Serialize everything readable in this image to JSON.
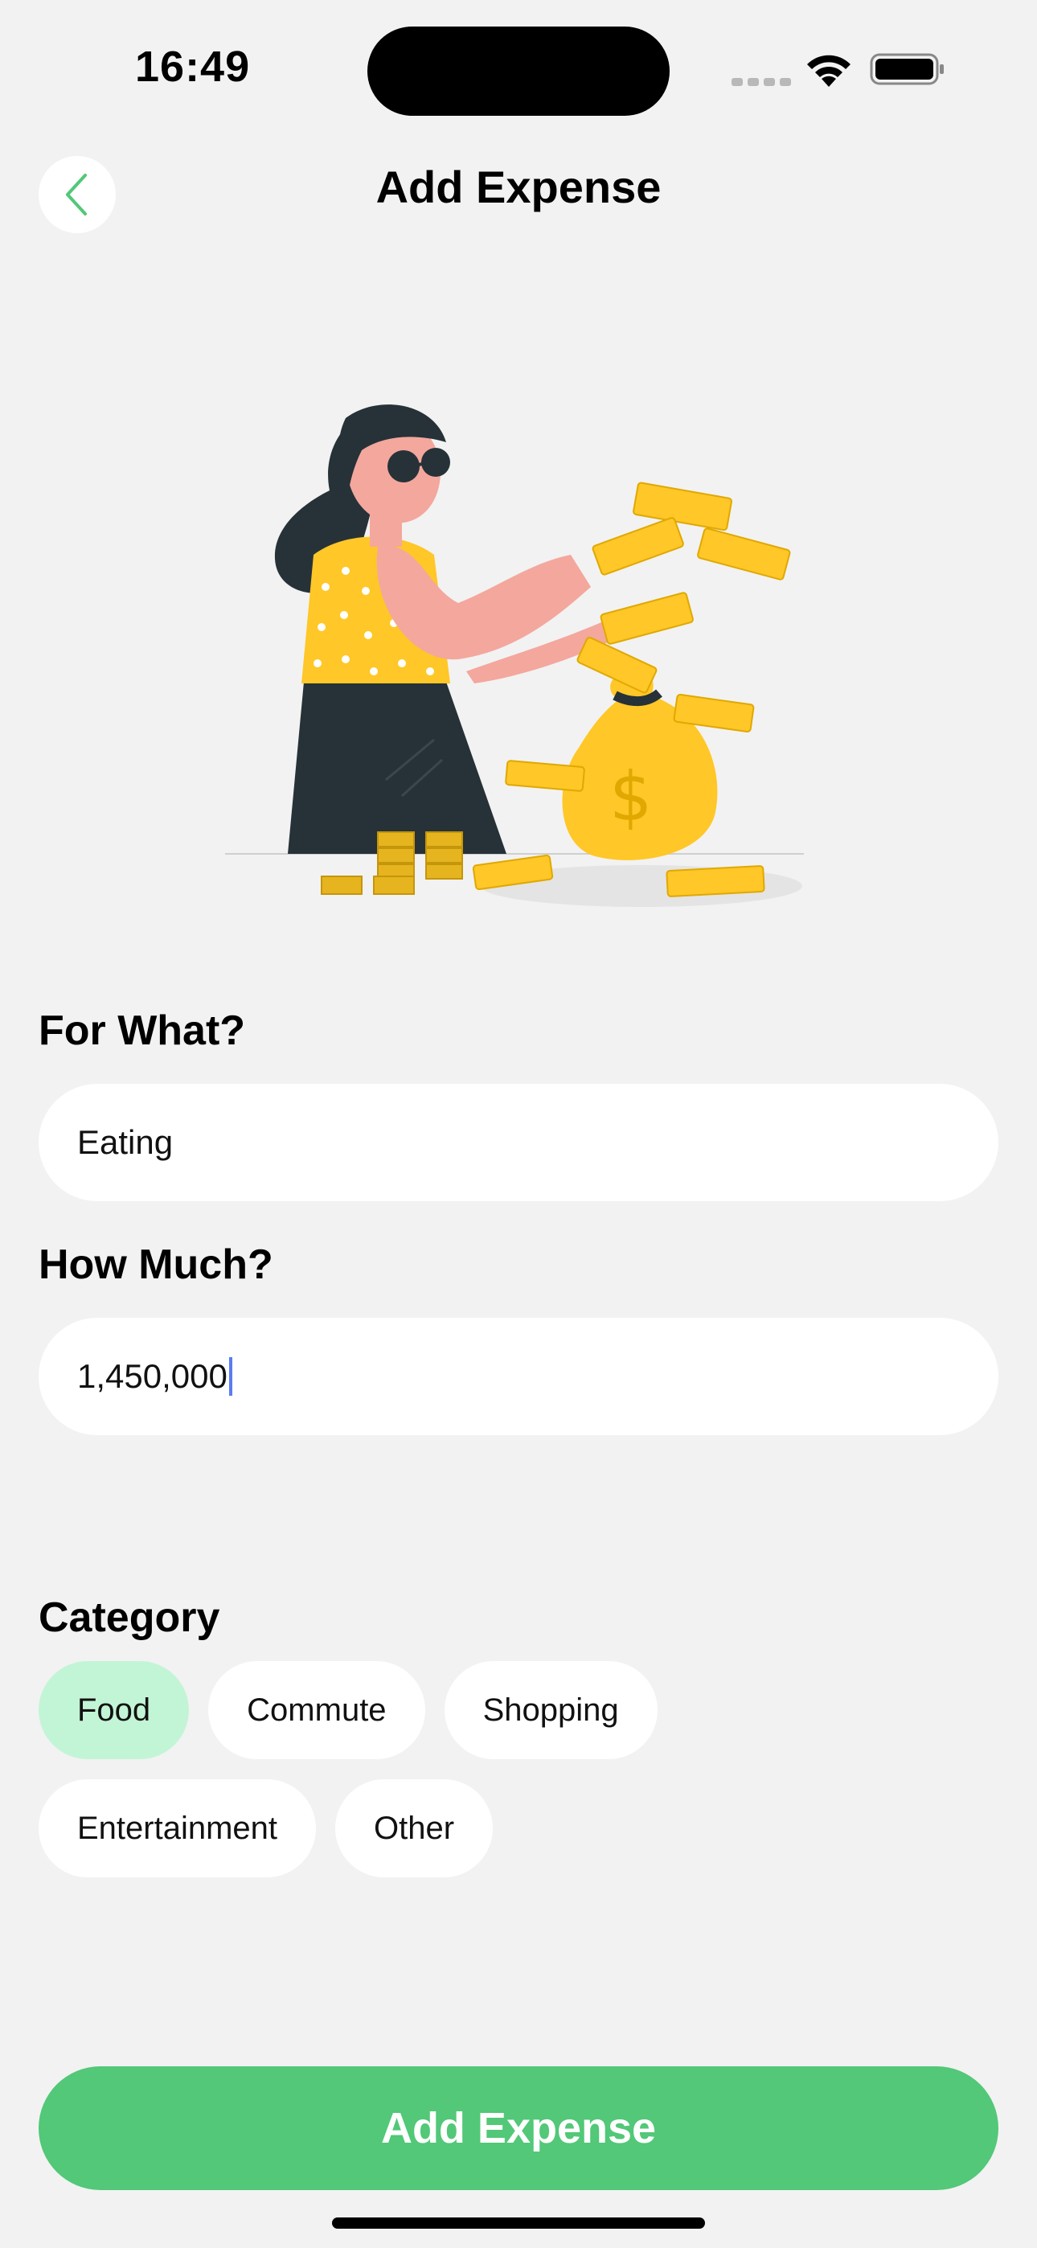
{
  "status_bar": {
    "time": "16:49"
  },
  "header": {
    "title": "Add Expense",
    "back_icon": "chevron-left-icon"
  },
  "form": {
    "what_label": "For What?",
    "what_value": "Eating",
    "amount_label": "How Much?",
    "amount_value": "1,450,000",
    "category_label": "Category",
    "categories": [
      "Food",
      "Commute",
      "Shopping",
      "Entertainment",
      "Other"
    ],
    "selected_category": "Food"
  },
  "submit": {
    "label": "Add Expense"
  },
  "colors": {
    "accent": "#52c878",
    "chip_selected": "#c2f5d6",
    "background": "#f2f2f2",
    "caret": "#5b7cf0"
  }
}
